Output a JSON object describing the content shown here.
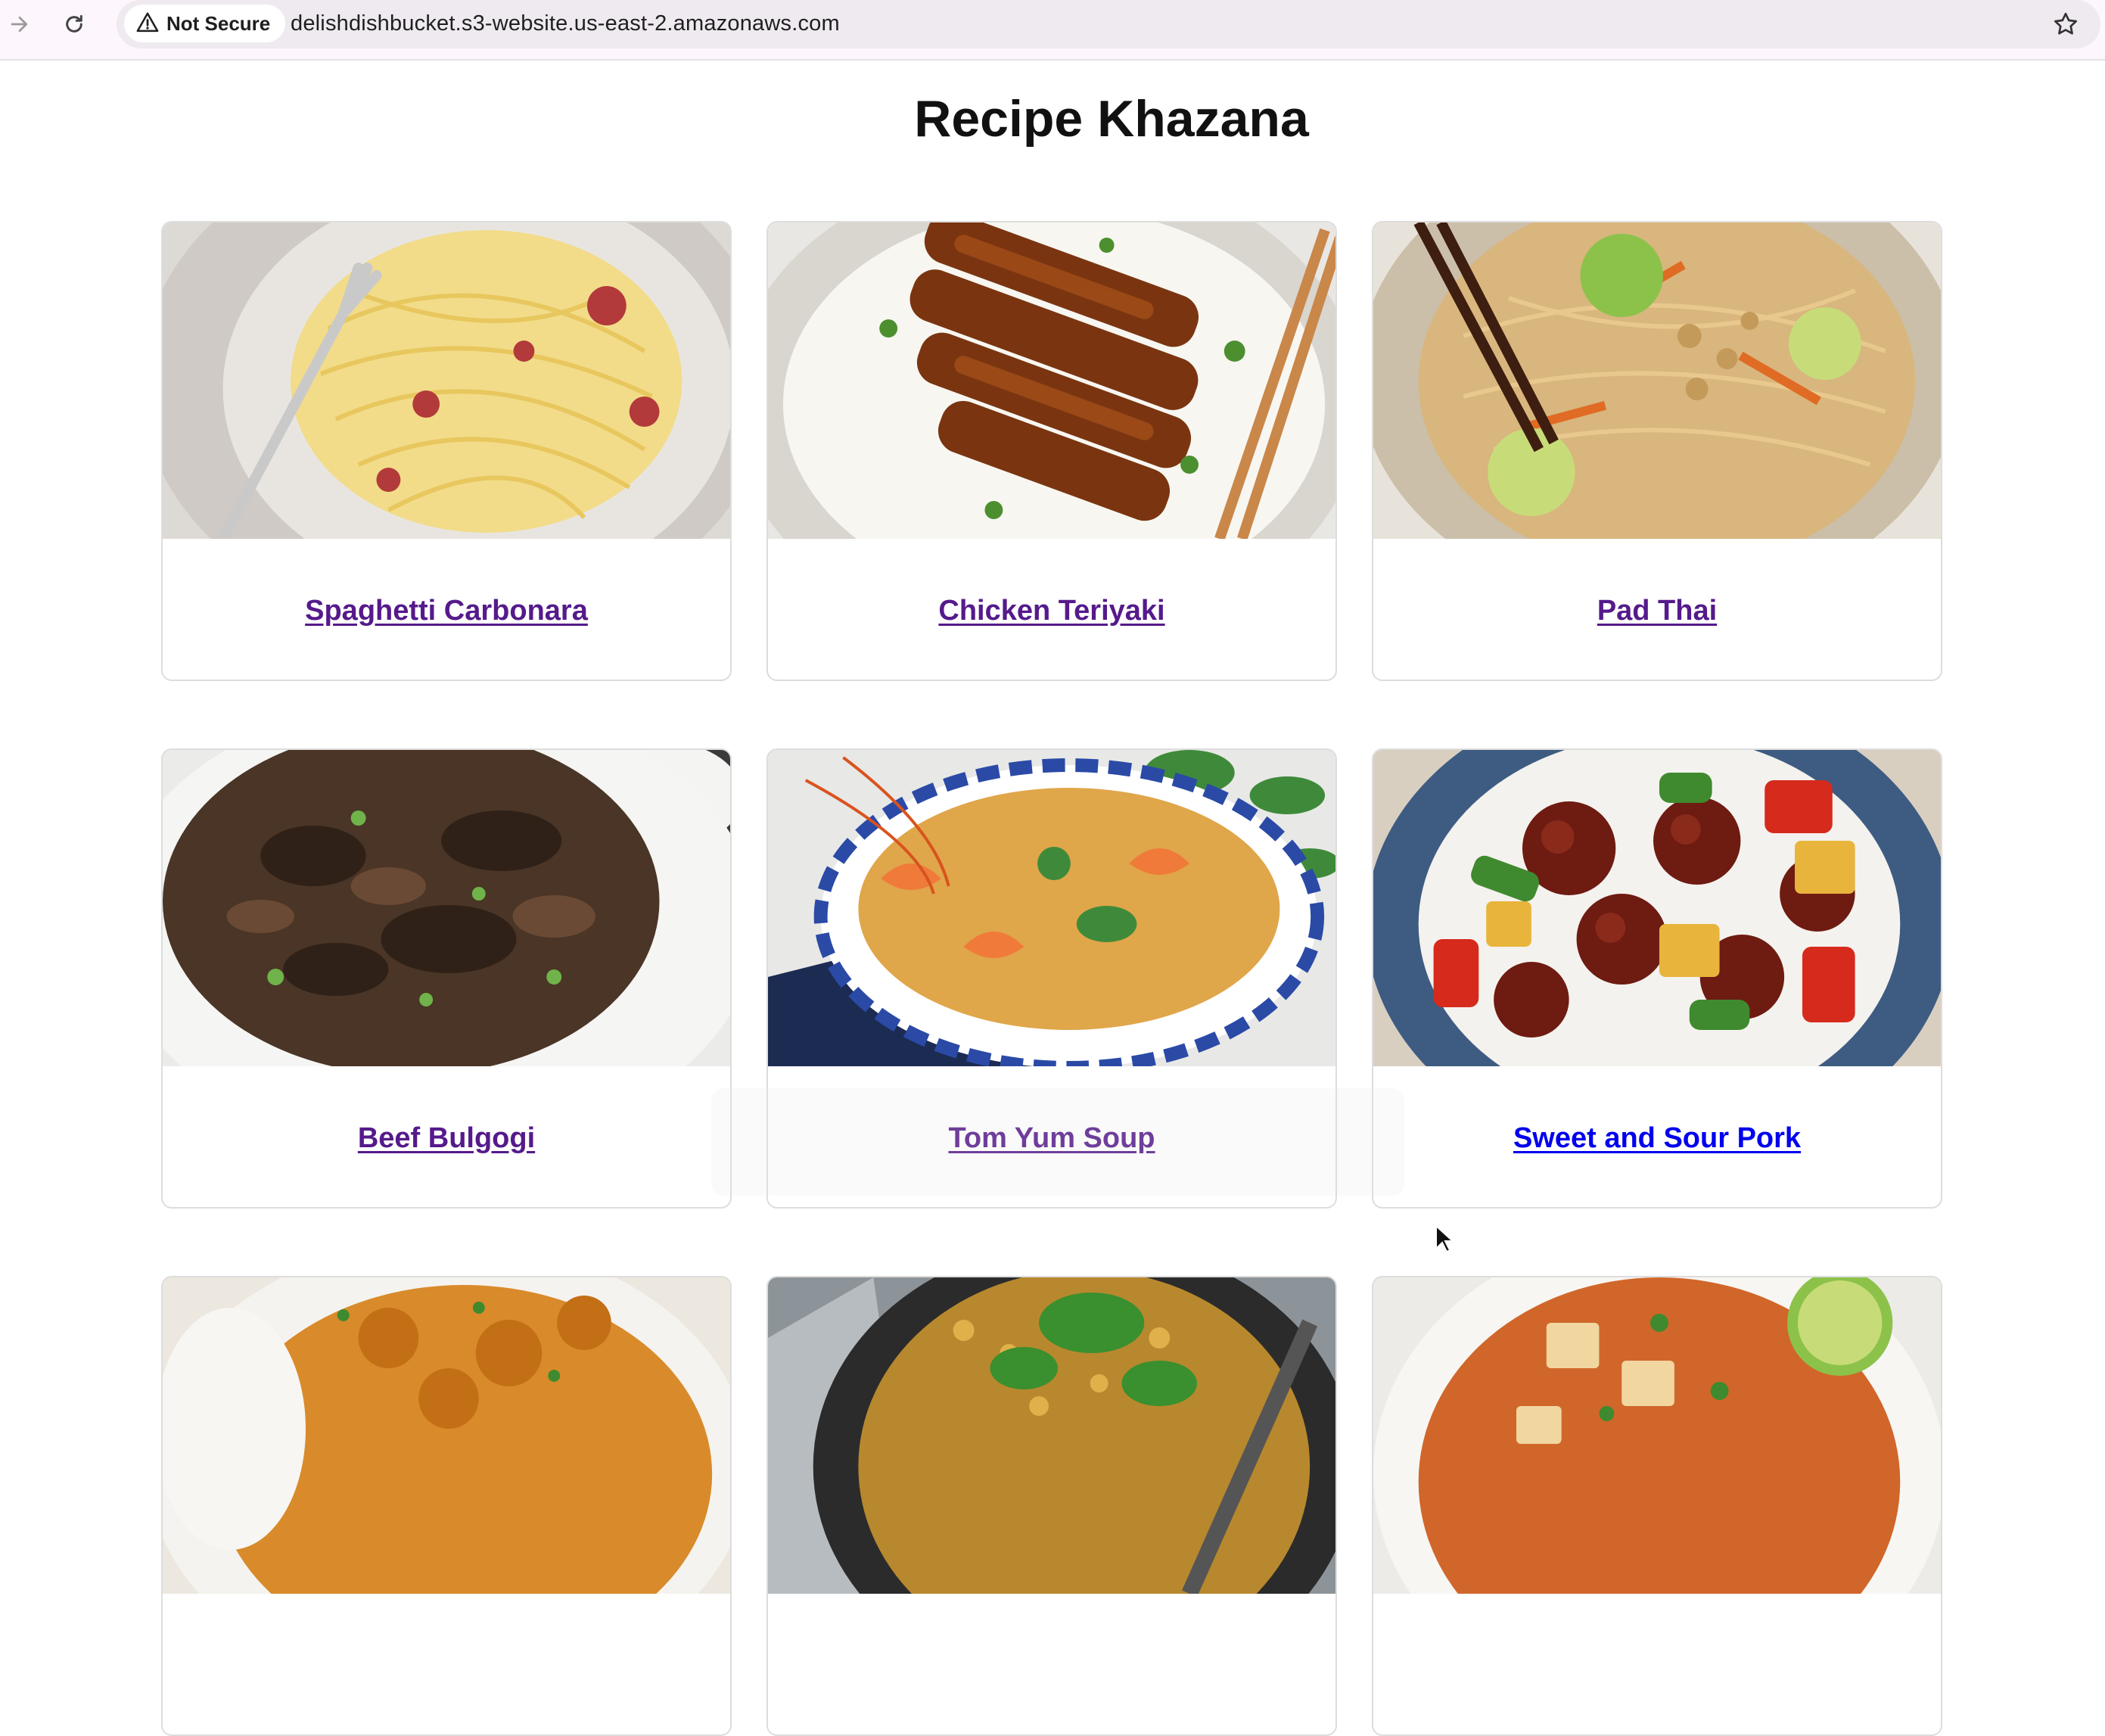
{
  "browser": {
    "security_label": "Not Secure",
    "url": "delishdishbucket.s3-website.us-east-2.amazonaws.com",
    "icons": {
      "forward": "forward-arrow-icon",
      "reload": "reload-icon",
      "warning": "warning-triangle-icon",
      "bookmark": "star-icon"
    }
  },
  "page": {
    "title": "Recipe Khazana"
  },
  "recipes": [
    {
      "name": "Spaghetti Carbonara",
      "visited": true
    },
    {
      "name": "Chicken Teriyaki",
      "visited": true
    },
    {
      "name": "Pad Thai",
      "visited": true
    },
    {
      "name": "Beef Bulgogi",
      "visited": true
    },
    {
      "name": "Tom Yum Soup",
      "visited": true
    },
    {
      "name": "Sweet and Sour Pork",
      "visited": false
    },
    {
      "name": "",
      "visited": false
    },
    {
      "name": "",
      "visited": false
    },
    {
      "name": "",
      "visited": false
    }
  ],
  "colors": {
    "visited_link": "#551a8b",
    "unvisited_link": "#0000ee",
    "card_border": "#dddddd"
  }
}
